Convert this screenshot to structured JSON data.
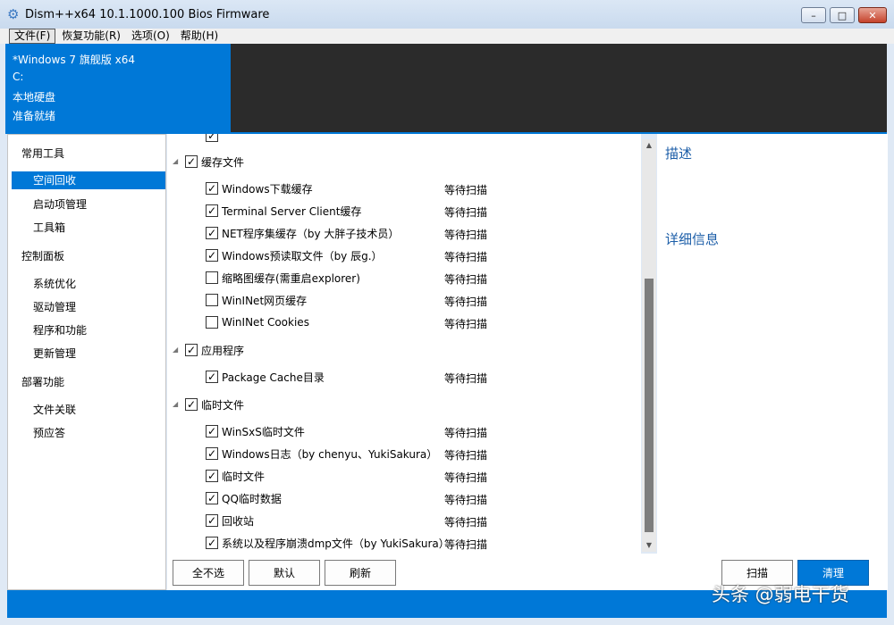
{
  "window": {
    "title": "Dism++x64 10.1.1000.100 Bios Firmware",
    "icon": "gears-icon",
    "controls": [
      "–",
      "□",
      "✕"
    ]
  },
  "menu": [
    {
      "label": "文件(F)",
      "active": true
    },
    {
      "label": "恢复功能(R)"
    },
    {
      "label": "选项(O)"
    },
    {
      "label": "帮助(H)"
    }
  ],
  "info": {
    "lines": [
      "*Windows 7 旗舰版 x64",
      "C:",
      "本地硬盘",
      "准备就绪"
    ]
  },
  "sidebar": {
    "groups": [
      {
        "label": "常用工具",
        "items": [
          "空间回收",
          "启动项管理",
          "工具箱"
        ]
      },
      {
        "label": "控制面板",
        "items": [
          "系统优化",
          "驱动管理",
          "程序和功能",
          "更新管理"
        ]
      },
      {
        "label": "部署功能",
        "items": [
          "文件关联",
          "预应答"
        ]
      }
    ],
    "selected": "空间回收"
  },
  "list": {
    "categories": [
      {
        "label": "缓存文件",
        "checked": true,
        "items": [
          {
            "label": "Windows下载缓存",
            "checked": true,
            "status": "等待扫描"
          },
          {
            "label": "Terminal Server Client缓存",
            "checked": true,
            "status": "等待扫描"
          },
          {
            "label": "NET程序集缓存（by 大胖子技术员）",
            "checked": true,
            "status": "等待扫描"
          },
          {
            "label": "Windows预读取文件（by 辰g.）",
            "checked": true,
            "status": "等待扫描"
          },
          {
            "label": "缩略图缓存(需重启explorer)",
            "checked": false,
            "status": "等待扫描"
          },
          {
            "label": "WinINet网页缓存",
            "checked": false,
            "status": "等待扫描"
          },
          {
            "label": "WinINet Cookies",
            "checked": false,
            "status": "等待扫描"
          }
        ]
      },
      {
        "label": "应用程序",
        "checked": true,
        "items": [
          {
            "label": "Package Cache目录",
            "checked": true,
            "status": "等待扫描"
          }
        ]
      },
      {
        "label": "临时文件",
        "checked": true,
        "items": [
          {
            "label": "WinSxS临时文件",
            "checked": true,
            "status": "等待扫描"
          },
          {
            "label": "Windows日志（by chenyu、YukiSakura）",
            "checked": true,
            "status": "等待扫描"
          },
          {
            "label": "临时文件",
            "checked": true,
            "status": "等待扫描"
          },
          {
            "label": "QQ临时数据",
            "checked": true,
            "status": "等待扫描"
          },
          {
            "label": "回收站",
            "checked": true,
            "status": "等待扫描"
          },
          {
            "label": "系统以及程序崩溃dmp文件（by YukiSakura）",
            "checked": true,
            "status": "等待扫描"
          }
        ]
      }
    ]
  },
  "detail": {
    "description_title": "描述",
    "details_title": "详细信息"
  },
  "buttons": {
    "select_none": "全不选",
    "default": "默认",
    "refresh": "刷新",
    "scan": "扫描",
    "clean": "清理"
  },
  "watermark": "头条 @弱电干货",
  "colors": {
    "accent": "#0078d7",
    "dark_panel": "#2b2b2b",
    "heading_blue": "#1c5ea8"
  }
}
